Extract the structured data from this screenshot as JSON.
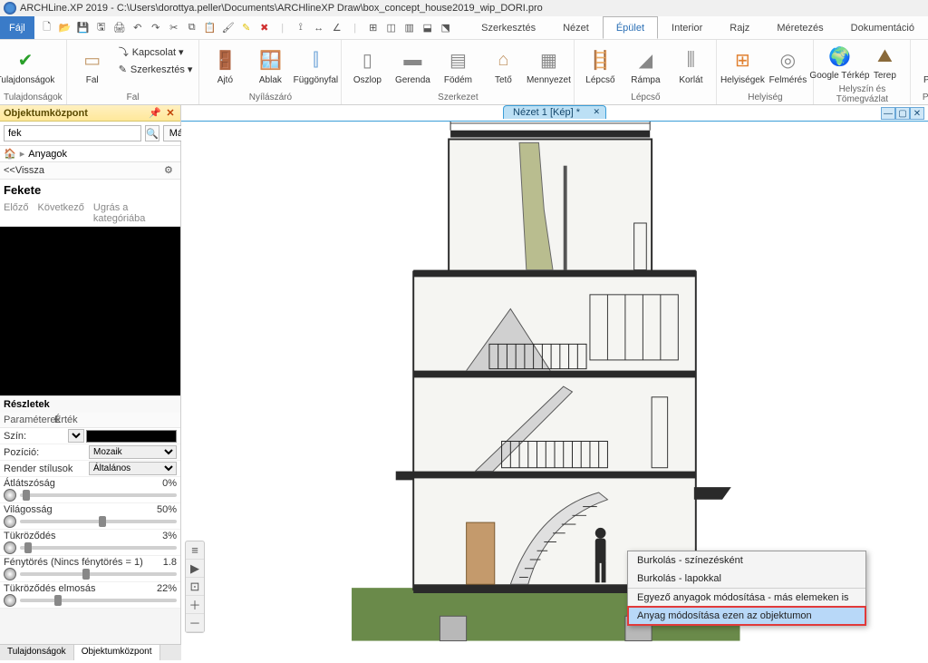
{
  "title": {
    "app": "ARCHLine.XP 2019",
    "path": "C:\\Users\\dorottya.peller\\Documents\\ARCHlineXP Draw\\box_concept_house2019_wip_DORI.pro"
  },
  "menubar": {
    "file": "Fájl",
    "tabs": [
      "Szerkesztés",
      "Nézet",
      "Épület",
      "Interior",
      "Rajz",
      "Méretezés",
      "Dokumentáció"
    ],
    "active": 2
  },
  "ribbon": {
    "groups": [
      {
        "label": "Tulajdonságok",
        "big": [
          {
            "icon": "✔",
            "text": "Tulajdonságok",
            "color": "#2aa02a"
          }
        ]
      },
      {
        "label": "Fal",
        "big": [
          {
            "icon": "▭",
            "text": "Fal",
            "color": "#c49a6c"
          }
        ],
        "small": [
          {
            "icon": "⤵",
            "text": "Kapcsolat ▾"
          },
          {
            "icon": "✎",
            "text": "Szerkesztés ▾"
          }
        ]
      },
      {
        "label": "Nyílászáró",
        "big": [
          {
            "icon": "🚪",
            "text": "Ajtó",
            "color": "#c49a6c"
          },
          {
            "icon": "🪟",
            "text": "Ablak",
            "color": "#6aa2d8"
          },
          {
            "icon": "⫿",
            "text": "Függönyfal",
            "color": "#6aa2d8"
          }
        ]
      },
      {
        "label": "Szerkezet",
        "big": [
          {
            "icon": "▯",
            "text": "Oszlop",
            "color": "#888"
          },
          {
            "icon": "▬",
            "text": "Gerenda",
            "color": "#888"
          },
          {
            "icon": "▤",
            "text": "Födém",
            "color": "#888"
          },
          {
            "icon": "⌂",
            "text": "Tető",
            "color": "#c49a6c"
          },
          {
            "icon": "▦",
            "text": "Mennyezet",
            "color": "#888"
          }
        ]
      },
      {
        "label": "Lépcső",
        "big": [
          {
            "icon": "🪜",
            "text": "Lépcső",
            "color": "#888"
          },
          {
            "icon": "◢",
            "text": "Rámpa",
            "color": "#888"
          },
          {
            "icon": "⫼",
            "text": "Korlát",
            "color": "#888"
          }
        ]
      },
      {
        "label": "Helyiség",
        "big": [
          {
            "icon": "⊞",
            "text": "Helyiségek",
            "color": "#e08030"
          },
          {
            "icon": "◎",
            "text": "Felmérés",
            "color": "#888"
          }
        ]
      },
      {
        "label": "Helyszín és Tömegvázlat",
        "big": [
          {
            "icon": "🌍",
            "text": "Google Térkép",
            "color": "#3a8a3a"
          },
          {
            "icon": "⛰",
            "text": "Terep",
            "color": "#8a6a3a"
          }
        ]
      },
      {
        "label": "Pontfel",
        "big": [
          {
            "icon": "∴",
            "text": "Pontfe",
            "color": "#888"
          }
        ]
      }
    ]
  },
  "panel": {
    "title": "Objektumközpont",
    "search_value": "fek",
    "brands": "Márkák",
    "breadcrumb": "Anyagok",
    "back": "<<Vissza",
    "category": "Fekete",
    "nav": {
      "prev": "Előző",
      "next": "Következő",
      "jump": "Ugrás a kategóriába"
    },
    "details": "Részletek",
    "param_cols": {
      "param": "Paraméterek",
      "value": "Érték"
    },
    "props": {
      "color_label": "Szín:",
      "pos_label": "Pozíció:",
      "pos_val": "Mozaik",
      "render_label": "Render stílusok",
      "render_val": "Általános"
    },
    "sliders": [
      {
        "label": "Átlátszóság",
        "val": "0%",
        "pos": 2
      },
      {
        "label": "Világosság",
        "val": "50%",
        "pos": 50
      },
      {
        "label": "Tükröződés",
        "val": "3%",
        "pos": 3
      },
      {
        "label": "Fénytörés (Nincs fénytörés = 1)",
        "val": "1.8",
        "pos": 40
      },
      {
        "label": "Tükröződés elmosás",
        "val": "22%",
        "pos": 22
      }
    ],
    "bottom_tabs": [
      "Tulajdonságok",
      "Objektumközpont"
    ]
  },
  "viewport": {
    "tab": "Nézet 1 [Kép] *"
  },
  "context_menu": {
    "items": [
      {
        "text": "Burkolás - színezésként"
      },
      {
        "text": "Burkolás - lapokkal",
        "sep": true
      },
      {
        "text": "Egyező anyagok módosítása - más elemeken is"
      },
      {
        "text": "Anyag módosítása ezen az objektumon",
        "highlight": true
      }
    ]
  }
}
